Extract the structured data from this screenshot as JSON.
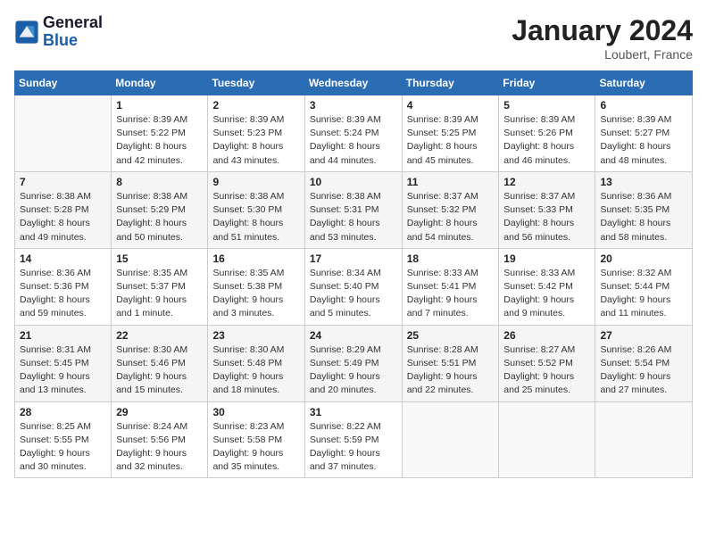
{
  "header": {
    "logo_line1": "General",
    "logo_line2": "Blue",
    "month": "January 2024",
    "location": "Loubert, France"
  },
  "days_of_week": [
    "Sunday",
    "Monday",
    "Tuesday",
    "Wednesday",
    "Thursday",
    "Friday",
    "Saturday"
  ],
  "weeks": [
    [
      {
        "day": "",
        "info": ""
      },
      {
        "day": "1",
        "info": "Sunrise: 8:39 AM\nSunset: 5:22 PM\nDaylight: 8 hours\nand 42 minutes."
      },
      {
        "day": "2",
        "info": "Sunrise: 8:39 AM\nSunset: 5:23 PM\nDaylight: 8 hours\nand 43 minutes."
      },
      {
        "day": "3",
        "info": "Sunrise: 8:39 AM\nSunset: 5:24 PM\nDaylight: 8 hours\nand 44 minutes."
      },
      {
        "day": "4",
        "info": "Sunrise: 8:39 AM\nSunset: 5:25 PM\nDaylight: 8 hours\nand 45 minutes."
      },
      {
        "day": "5",
        "info": "Sunrise: 8:39 AM\nSunset: 5:26 PM\nDaylight: 8 hours\nand 46 minutes."
      },
      {
        "day": "6",
        "info": "Sunrise: 8:39 AM\nSunset: 5:27 PM\nDaylight: 8 hours\nand 48 minutes."
      }
    ],
    [
      {
        "day": "7",
        "info": "Sunrise: 8:38 AM\nSunset: 5:28 PM\nDaylight: 8 hours\nand 49 minutes."
      },
      {
        "day": "8",
        "info": "Sunrise: 8:38 AM\nSunset: 5:29 PM\nDaylight: 8 hours\nand 50 minutes."
      },
      {
        "day": "9",
        "info": "Sunrise: 8:38 AM\nSunset: 5:30 PM\nDaylight: 8 hours\nand 51 minutes."
      },
      {
        "day": "10",
        "info": "Sunrise: 8:38 AM\nSunset: 5:31 PM\nDaylight: 8 hours\nand 53 minutes."
      },
      {
        "day": "11",
        "info": "Sunrise: 8:37 AM\nSunset: 5:32 PM\nDaylight: 8 hours\nand 54 minutes."
      },
      {
        "day": "12",
        "info": "Sunrise: 8:37 AM\nSunset: 5:33 PM\nDaylight: 8 hours\nand 56 minutes."
      },
      {
        "day": "13",
        "info": "Sunrise: 8:36 AM\nSunset: 5:35 PM\nDaylight: 8 hours\nand 58 minutes."
      }
    ],
    [
      {
        "day": "14",
        "info": "Sunrise: 8:36 AM\nSunset: 5:36 PM\nDaylight: 8 hours\nand 59 minutes."
      },
      {
        "day": "15",
        "info": "Sunrise: 8:35 AM\nSunset: 5:37 PM\nDaylight: 9 hours\nand 1 minute."
      },
      {
        "day": "16",
        "info": "Sunrise: 8:35 AM\nSunset: 5:38 PM\nDaylight: 9 hours\nand 3 minutes."
      },
      {
        "day": "17",
        "info": "Sunrise: 8:34 AM\nSunset: 5:40 PM\nDaylight: 9 hours\nand 5 minutes."
      },
      {
        "day": "18",
        "info": "Sunrise: 8:33 AM\nSunset: 5:41 PM\nDaylight: 9 hours\nand 7 minutes."
      },
      {
        "day": "19",
        "info": "Sunrise: 8:33 AM\nSunset: 5:42 PM\nDaylight: 9 hours\nand 9 minutes."
      },
      {
        "day": "20",
        "info": "Sunrise: 8:32 AM\nSunset: 5:44 PM\nDaylight: 9 hours\nand 11 minutes."
      }
    ],
    [
      {
        "day": "21",
        "info": "Sunrise: 8:31 AM\nSunset: 5:45 PM\nDaylight: 9 hours\nand 13 minutes."
      },
      {
        "day": "22",
        "info": "Sunrise: 8:30 AM\nSunset: 5:46 PM\nDaylight: 9 hours\nand 15 minutes."
      },
      {
        "day": "23",
        "info": "Sunrise: 8:30 AM\nSunset: 5:48 PM\nDaylight: 9 hours\nand 18 minutes."
      },
      {
        "day": "24",
        "info": "Sunrise: 8:29 AM\nSunset: 5:49 PM\nDaylight: 9 hours\nand 20 minutes."
      },
      {
        "day": "25",
        "info": "Sunrise: 8:28 AM\nSunset: 5:51 PM\nDaylight: 9 hours\nand 22 minutes."
      },
      {
        "day": "26",
        "info": "Sunrise: 8:27 AM\nSunset: 5:52 PM\nDaylight: 9 hours\nand 25 minutes."
      },
      {
        "day": "27",
        "info": "Sunrise: 8:26 AM\nSunset: 5:54 PM\nDaylight: 9 hours\nand 27 minutes."
      }
    ],
    [
      {
        "day": "28",
        "info": "Sunrise: 8:25 AM\nSunset: 5:55 PM\nDaylight: 9 hours\nand 30 minutes."
      },
      {
        "day": "29",
        "info": "Sunrise: 8:24 AM\nSunset: 5:56 PM\nDaylight: 9 hours\nand 32 minutes."
      },
      {
        "day": "30",
        "info": "Sunrise: 8:23 AM\nSunset: 5:58 PM\nDaylight: 9 hours\nand 35 minutes."
      },
      {
        "day": "31",
        "info": "Sunrise: 8:22 AM\nSunset: 5:59 PM\nDaylight: 9 hours\nand 37 minutes."
      },
      {
        "day": "",
        "info": ""
      },
      {
        "day": "",
        "info": ""
      },
      {
        "day": "",
        "info": ""
      }
    ]
  ]
}
